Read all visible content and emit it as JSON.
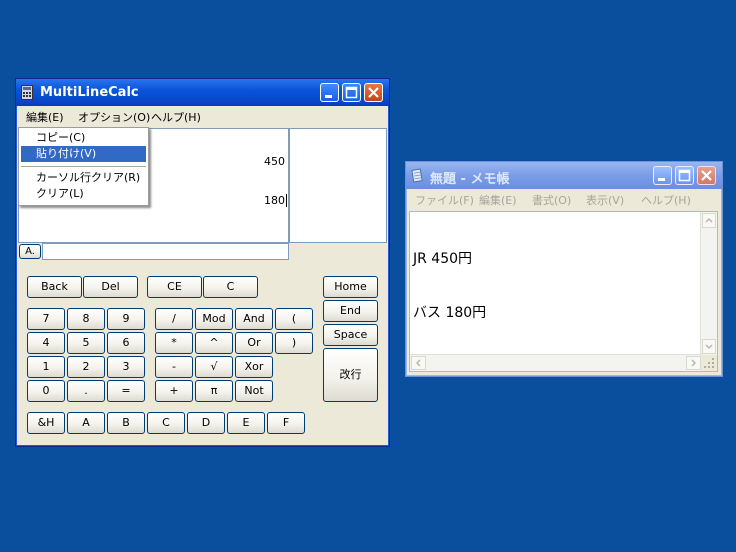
{
  "calc": {
    "title": "MultiLineCalc",
    "menus": [
      "編集(E)",
      "オプション(O)",
      "ヘルプ(H)"
    ],
    "edit_menu": {
      "items": [
        "コピー(C)",
        "貼り付け(V)",
        "カーソル行クリア(R)",
        "クリア(L)"
      ],
      "highlighted_index": 1
    },
    "lines": [
      "450",
      "180"
    ],
    "mode_label": "A.",
    "input_value": "",
    "buttons": {
      "back": "Back",
      "del": "Del",
      "ce": "CE",
      "c": "C",
      "n7": "7",
      "n8": "8",
      "n9": "9",
      "n4": "4",
      "n5": "5",
      "n6": "6",
      "n1": "1",
      "n2": "2",
      "n3": "3",
      "n0": "0",
      "dot": ".",
      "eq": "=",
      "div": "/",
      "mod": "Mod",
      "and": "And",
      "lparen": "(",
      "mul": "*",
      "pow": "^",
      "or": "Or",
      "rparen": ")",
      "sub": "-",
      "sqrt": "√",
      "xor": "Xor",
      "add": "+",
      "pi": "π",
      "not": "Not",
      "home": "Home",
      "end": "End",
      "space": "Space",
      "enter": "改行",
      "hex": "&H",
      "a": "A",
      "b": "B",
      "c_hex": "C",
      "d": "D",
      "e": "E",
      "f": "F"
    }
  },
  "notepad": {
    "title": "無題 - メモ帳",
    "menus": [
      "ファイル(F)",
      "編集(E)",
      "書式(O)",
      "表示(V)",
      "ヘルプ(H)"
    ],
    "text_lines": [
      "JR 450円",
      "バス 180円"
    ]
  },
  "colors": {
    "desktop": "#0a4f9e",
    "titlebar_active": "#0a54d8",
    "titlebar_inactive": "#7b9de8",
    "menu_highlight": "#316ac5"
  }
}
